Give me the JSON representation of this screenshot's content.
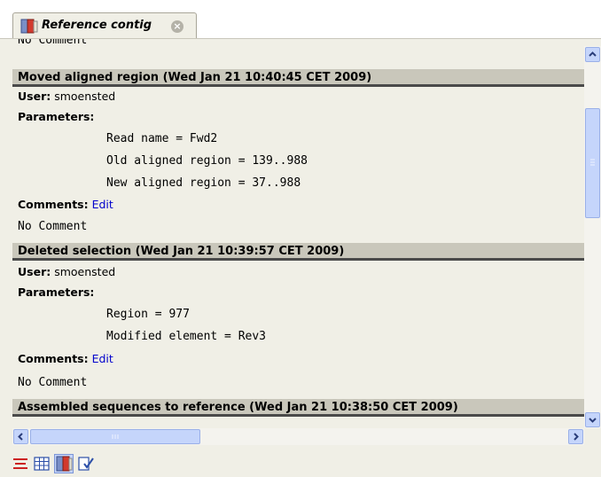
{
  "tab": {
    "title": "Reference contig",
    "icon": "contig-book-icon",
    "close_icon": "close-icon"
  },
  "history": {
    "top_clipped_line": "No Comment",
    "entries": [
      {
        "title": "Moved aligned region (Wed Jan 21 10:40:45 CET 2009)",
        "user_label": "User:",
        "user": "smoensted",
        "parameters_label": "Parameters:",
        "parameters": [
          "Read name = Fwd2",
          "Old aligned region = 139..988",
          "New aligned region = 37..988"
        ],
        "comments_label": "Comments:",
        "edit_label": "Edit",
        "comment": "No Comment"
      },
      {
        "title": "Deleted selection (Wed Jan 21 10:39:57 CET 2009)",
        "user_label": "User:",
        "user": "smoensted",
        "parameters_label": "Parameters:",
        "parameters": [
          "Region = 977",
          "Modified element = Rev3"
        ],
        "comments_label": "Comments:",
        "edit_label": "Edit",
        "comment": "No Comment"
      },
      {
        "title": "Assembled sequences to reference (Wed Jan 21 10:38:50 CET 2009)"
      }
    ]
  },
  "bottom_toolbar": {
    "icons": [
      "lines-view-icon",
      "table-view-icon",
      "contig-book-icon",
      "edit-check-icon"
    ]
  },
  "colors": {
    "header_bg": "#c9c7bb",
    "panel_bg": "#f0efe6",
    "link": "#0000cc",
    "scroll": "#c5d5fb"
  }
}
